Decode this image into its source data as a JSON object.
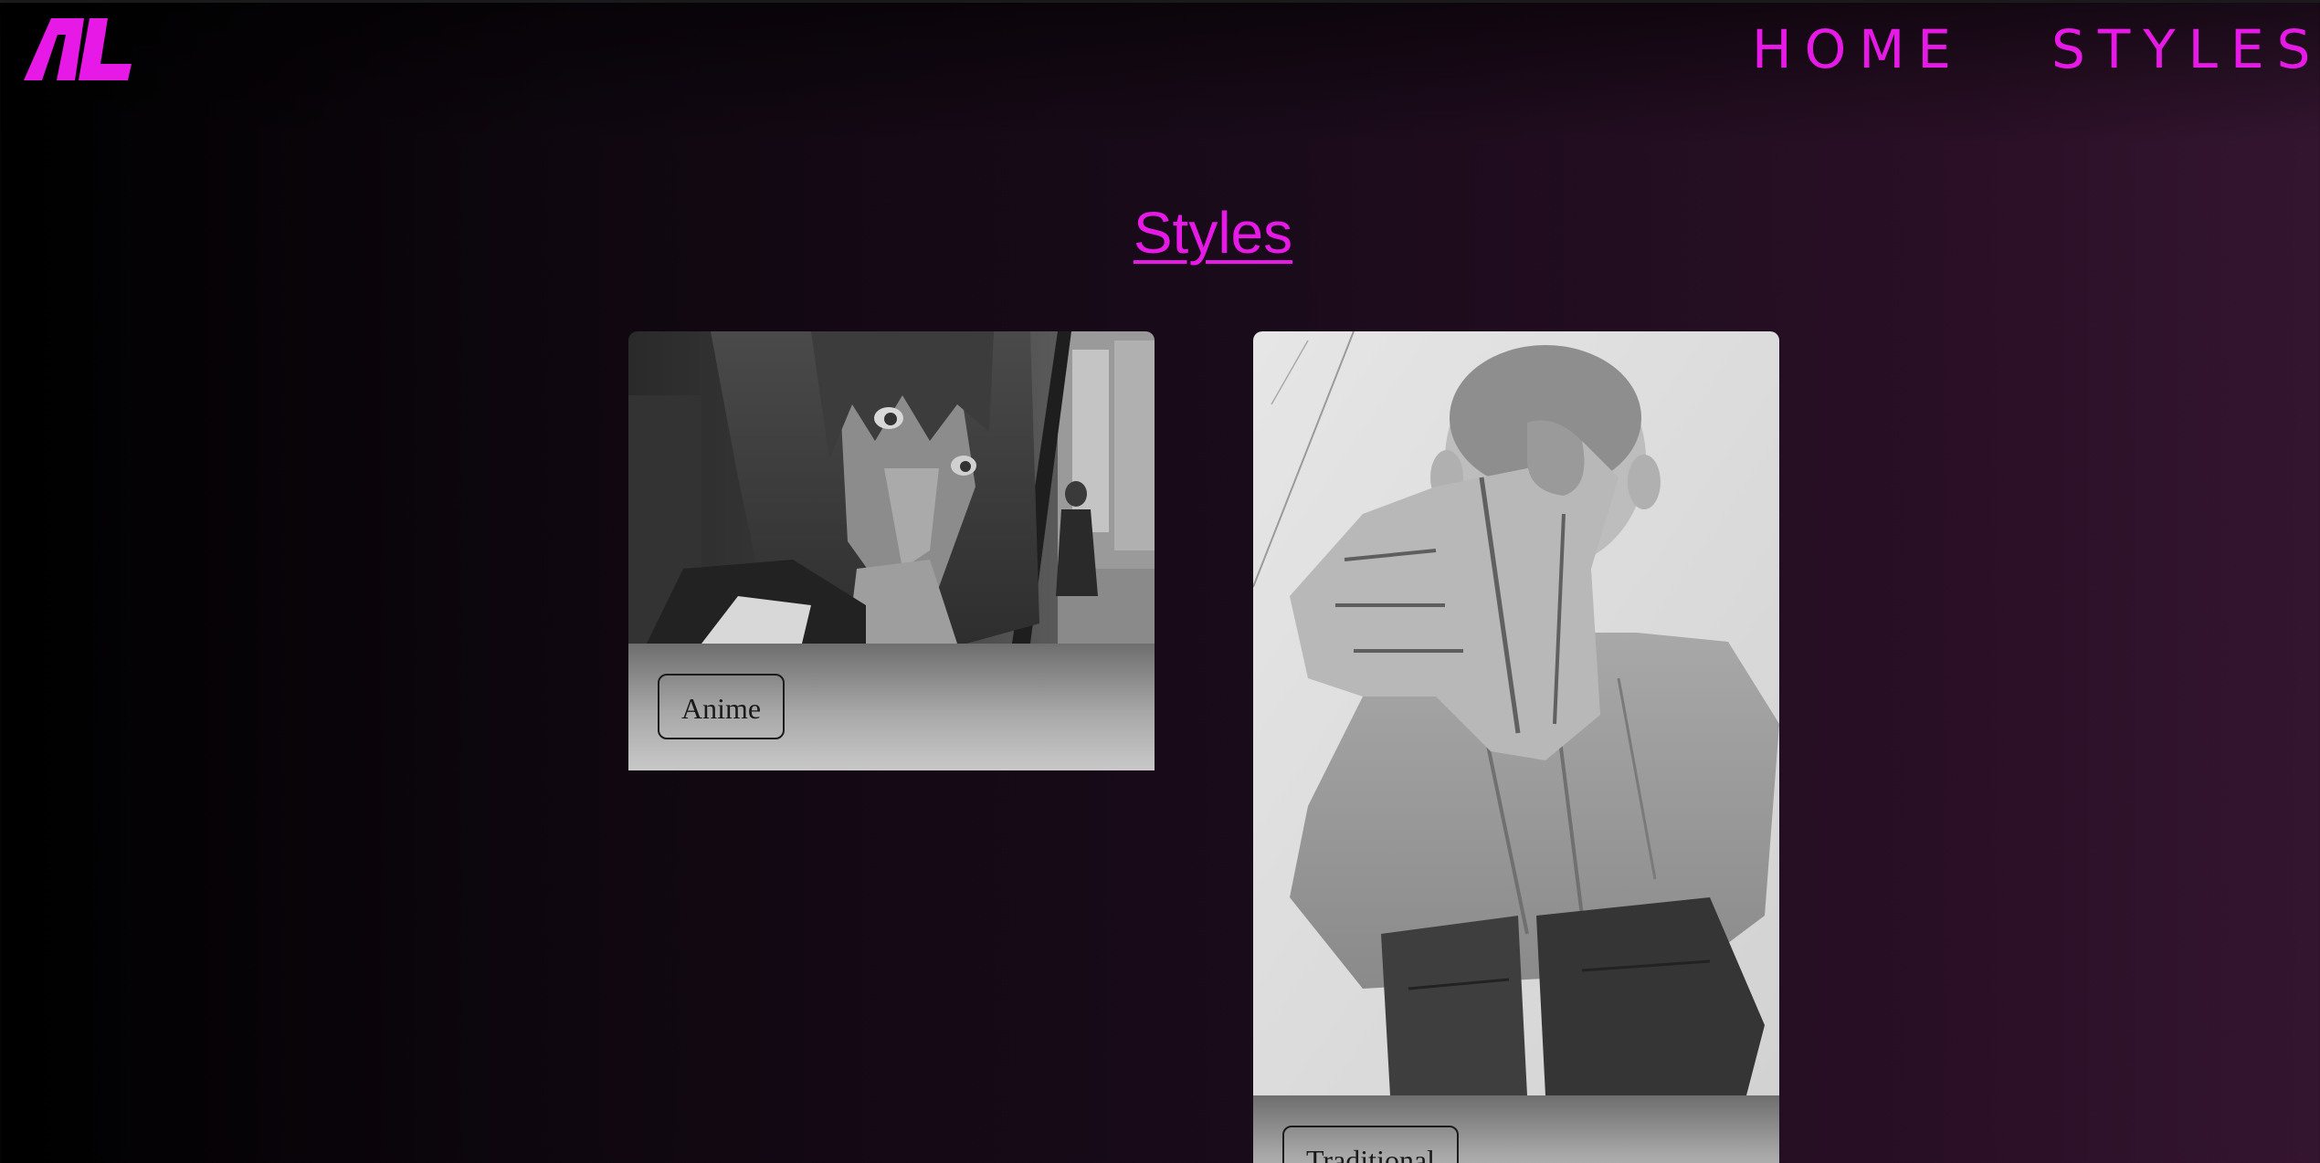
{
  "header": {
    "logo_text": "AL",
    "nav": [
      {
        "label": "HOME"
      },
      {
        "label": "STYLES"
      }
    ]
  },
  "main": {
    "title": "Styles",
    "cards": [
      {
        "label": "Anime",
        "image": "anime-girl-in-car-grayscale"
      },
      {
        "label": "Traditional",
        "image": "pencil-sketch-boy-pointing"
      }
    ]
  },
  "colors": {
    "accent": "#e619e6",
    "background_start": "#000000",
    "background_end": "#341530"
  }
}
